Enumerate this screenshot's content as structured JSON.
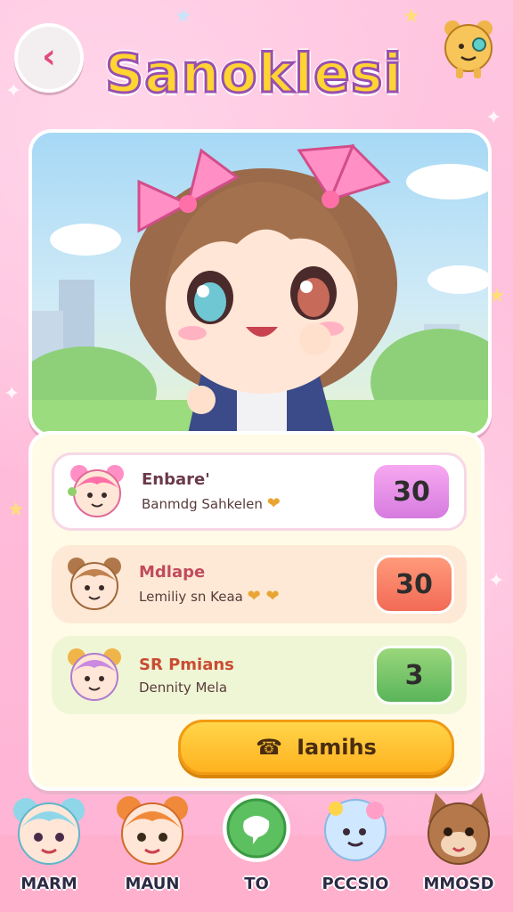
{
  "header": {
    "back_icon": "chevron-left-icon",
    "title": "Sanoklesi"
  },
  "scores": [
    {
      "name": "Enbare'",
      "subtitle": "Banmdg Sahkelen",
      "score": "30",
      "tone": "pink"
    },
    {
      "name": "Mdlape",
      "subtitle": "Lemiliy sn Keaa",
      "score": "30",
      "tone": "orange"
    },
    {
      "name": "SR Pmians",
      "subtitle": "Dennity Mela",
      "score": "3",
      "tone": "green"
    }
  ],
  "cta": {
    "label": "Iamihs",
    "icon": "phone-icon"
  },
  "nav": [
    {
      "label": "MARM"
    },
    {
      "label": "MAUN"
    },
    {
      "label": "TO"
    },
    {
      "label": "PCCSIO"
    },
    {
      "label": "MMOSD"
    }
  ],
  "colors": {
    "background": "#ffc6e0",
    "title": "#ffd531",
    "cta": "#ffc02e"
  }
}
